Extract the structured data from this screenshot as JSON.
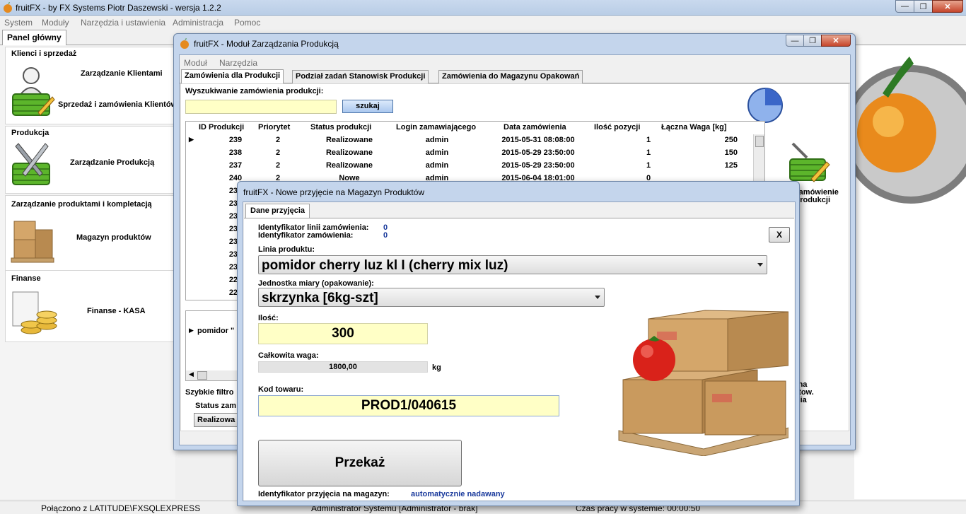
{
  "main": {
    "title": "fruitFX - by FX Systems Piotr Daszewski - wersja 1.2.2",
    "menu": [
      "System",
      "Moduły",
      "Narzędzia i ustawienia",
      "Administracja",
      "Pomoc"
    ],
    "tab": "Panel główny",
    "groups": {
      "clients": {
        "title": "Klienci i sprzedaż",
        "item1": "Zarządzanie Klientami",
        "item2": "Sprzedaż i zamówienia Klientów"
      },
      "production": {
        "title": "Produkcja",
        "item1": "Zarządzanie Produkcją"
      },
      "products": {
        "title": "Zarządzanie produktami i kompletacją",
        "item1": "Magazyn produktów"
      },
      "finance": {
        "title": "Finanse",
        "item1": "Finanse - KASA"
      }
    },
    "right_labels": {
      "l1": "zanie na",
      "l2": "yn Gotow.",
      "l3": "zlecenia"
    },
    "status": {
      "connection": "Połączono z LATITUDE\\FXSQLEXPRESS",
      "user": "Administrator Systemu [Administrator - brak]",
      "worktime": "Czas pracy w systemie: 00:00:50"
    }
  },
  "prod": {
    "title": "fruitFX - Moduł Zarządzania Produkcją",
    "menu": [
      "Moduł",
      "Narzędzia"
    ],
    "tabs": [
      "Zamówienia dla Produkcji",
      "Podział zadań Stanowisk Produkcji",
      "Zamówienia do Magazynu Opakowań"
    ],
    "search_label": "Wyszukiwanie zamówienia produkcji:",
    "search_button": "szukaj",
    "new_order": {
      "line1": "nowe zamówienie",
      "line2": "do produkcji"
    },
    "columns": [
      "ID Produkcji",
      "Priorytet",
      "Status produkcji",
      "Login zamawiającego",
      "Data zamówienia",
      "Ilość pozycji",
      "Łączna Waga [kg]"
    ],
    "rows": [
      {
        "id": "239",
        "prio": "2",
        "status": "Realizowane",
        "login": "admin",
        "date": "2015-05-31 08:08:00",
        "count": "1",
        "weight": "250"
      },
      {
        "id": "238",
        "prio": "2",
        "status": "Realizowane",
        "login": "admin",
        "date": "2015-05-29 23:50:00",
        "count": "1",
        "weight": "150"
      },
      {
        "id": "237",
        "prio": "2",
        "status": "Realizowane",
        "login": "admin",
        "date": "2015-05-29 23:50:00",
        "count": "1",
        "weight": "125"
      },
      {
        "id": "240",
        "prio": "2",
        "status": "Nowe",
        "login": "admin",
        "date": "2015-06-04 18:01:00",
        "count": "0",
        "weight": ""
      },
      {
        "id": "236"
      },
      {
        "id": "235"
      },
      {
        "id": "234"
      },
      {
        "id": "233"
      },
      {
        "id": "232"
      },
      {
        "id": "231"
      },
      {
        "id": "230"
      },
      {
        "id": "229"
      },
      {
        "id": "228"
      }
    ],
    "detail_row": "pomidor \"",
    "quick_filter": "Szybkie filtro",
    "status_filter_label": "Status zam",
    "status_filter_value": "Realizowa"
  },
  "dlg": {
    "title": "fruitFX - Nowe przyjęcie na Magazyn Produktów",
    "tab": "Dane przyjęcia",
    "line_id_label": "Identyfikator linii zamówienia:",
    "line_id_value": "0",
    "order_id_label": "Identyfikator zamówienia:",
    "order_id_value": "0",
    "close_label": "X",
    "product_line_label": "Linia produktu:",
    "product_line_value": "pomidor cherry luz kl I (cherry mix luz)",
    "unit_label": "Jednostka miary (opakowanie):",
    "unit_value": "skrzynka [6kg-szt]",
    "qty_label": "Ilość:",
    "qty_value": "300",
    "weight_label": "Całkowita waga:",
    "weight_value": "1800,00",
    "weight_unit": "kg",
    "code_label": "Kod towaru:",
    "code_value": "PROD1/040615",
    "pass_button": "Przekaż",
    "receipt_id_label": "Identyfikator przyjęcia na magazyn:",
    "receipt_id_value": "automatycznie nadawany"
  },
  "colors": {
    "accent": "#1a3a9c",
    "input_yellow": "#ffffc6",
    "title_blue": "#c4d5ec"
  }
}
